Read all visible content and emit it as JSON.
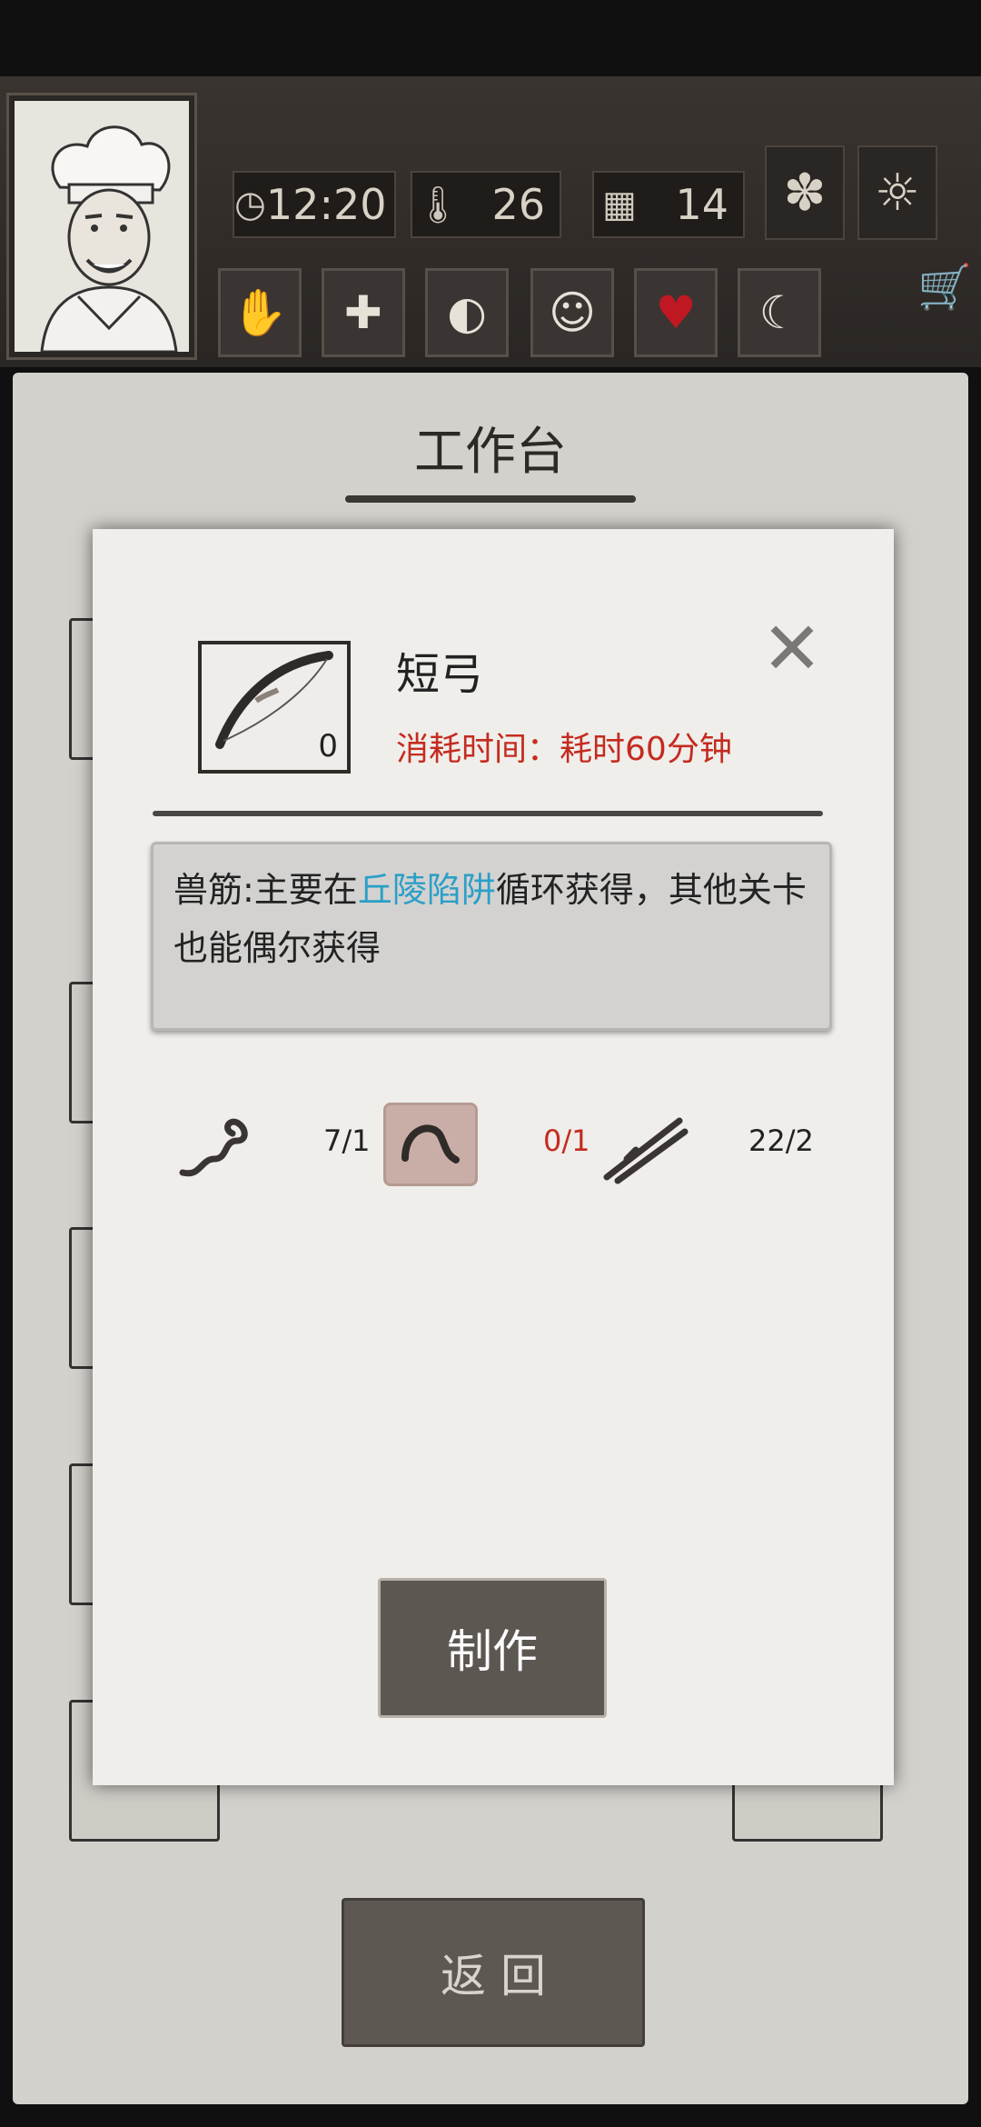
{
  "hud": {
    "time": "12:20",
    "temperature": "26",
    "day": "14",
    "icons": [
      "clock-icon",
      "thermometer-icon",
      "calendar-icon",
      "leaf-icon",
      "sun-icon"
    ],
    "status_tabs": [
      "bandaged-hand-icon",
      "medical-cross-icon",
      "stomach-icon",
      "head-icon",
      "heart-icon",
      "moon-icon"
    ],
    "cart_icon": "cart-icon"
  },
  "workbench": {
    "title": "工作台",
    "back_label": "返 回"
  },
  "dialog": {
    "item_name": "短弓",
    "item_count": "0",
    "craft_time_label": "消耗时间：",
    "craft_time_value": "耗时60分钟",
    "tooltip": {
      "prefix": "兽筋:主要在",
      "highlight": "丘陵陷阱",
      "suffix": "循环获得，其他关卡也能偶尔获得"
    },
    "materials": [
      {
        "icon": "rope-icon",
        "count": "7/1",
        "color": "#222222"
      },
      {
        "icon": "sinew-icon",
        "count": "0/1",
        "color": "#c42b20"
      },
      {
        "icon": "sticks-icon",
        "count": "22/2",
        "color": "#222222"
      }
    ],
    "craft_label": "制作",
    "close_icon": "close-icon"
  }
}
